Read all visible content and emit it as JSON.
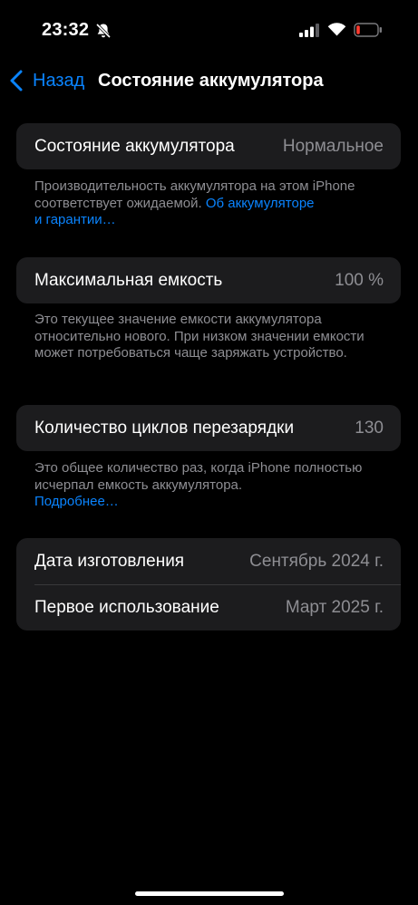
{
  "status_bar": {
    "time": "23:32",
    "icons": [
      "bell-slash-icon",
      "cellular-signal-icon",
      "wifi-icon",
      "battery-low-icon"
    ],
    "battery_color": "#ff3b30"
  },
  "nav": {
    "back_label": "Назад",
    "title": "Состояние аккумулятора",
    "accent_color": "#0a84ff"
  },
  "battery_health": {
    "label": "Состояние аккумулятора",
    "value": "Нормальное",
    "footer_text": "Производительность аккумулятора на этом iPhone соответствует ожидаемой.",
    "footer_link_line1": "Об аккумуляторе",
    "footer_link_line2": "и гарантии…"
  },
  "max_capacity": {
    "label": "Максимальная емкость",
    "value": "100 %",
    "footer_text": "Это текущее значение емкости аккумулятора относительно нового. При низком значении емкости может потребоваться чаще заряжать устройство."
  },
  "cycle_count": {
    "label": "Количество циклов перезарядки",
    "value": "130",
    "footer_text": "Это общее количество раз, когда iPhone полностью исчерпал емкость аккумулятора.",
    "footer_link": "Подробнее…"
  },
  "dates": {
    "manufacture_label": "Дата изготовления",
    "manufacture_value": "Сентябрь 2024 г.",
    "first_use_label": "Первое использование",
    "first_use_value": "Март 2025 г."
  }
}
